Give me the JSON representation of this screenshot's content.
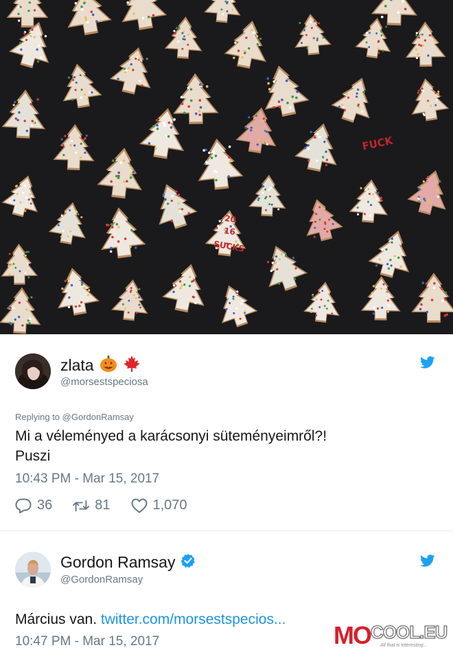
{
  "photo": {
    "icon": "christmas-cookies-photo",
    "cookie_writing": [
      "FUCK",
      "20",
      "16",
      "SUCKS"
    ]
  },
  "tweet1": {
    "display_name": "zlata",
    "emoji_icons": [
      "jack-o-lantern-icon",
      "maple-leaf-icon"
    ],
    "handle": "@morsestspeciosa",
    "replying_to": "Replying to @GordonRamsay",
    "text_line1": "Mi a véleményed a karácsonyi süteményeimről?!",
    "text_line2": "Puszi",
    "timestamp": "10:43 PM - Mar 15, 2017",
    "replies": "36",
    "retweets": "81",
    "likes": "1,070"
  },
  "tweet2": {
    "display_name": "Gordon Ramsay",
    "verified": true,
    "handle": "@GordonRamsay",
    "text_prefix": "Március van. ",
    "link_text": "twitter.com/morsestspecios...",
    "timestamp": "10:47 PM - Mar 15, 2017"
  },
  "watermark": {
    "brand_mo": "MO",
    "brand_cool": "COOL.EU",
    "tagline": "All that is interesting..."
  },
  "colors": {
    "twitter_blue": "#1da1f2",
    "link": "#1b95e0",
    "secondary_text": "#657786",
    "watermark_red": "#d6202a"
  }
}
